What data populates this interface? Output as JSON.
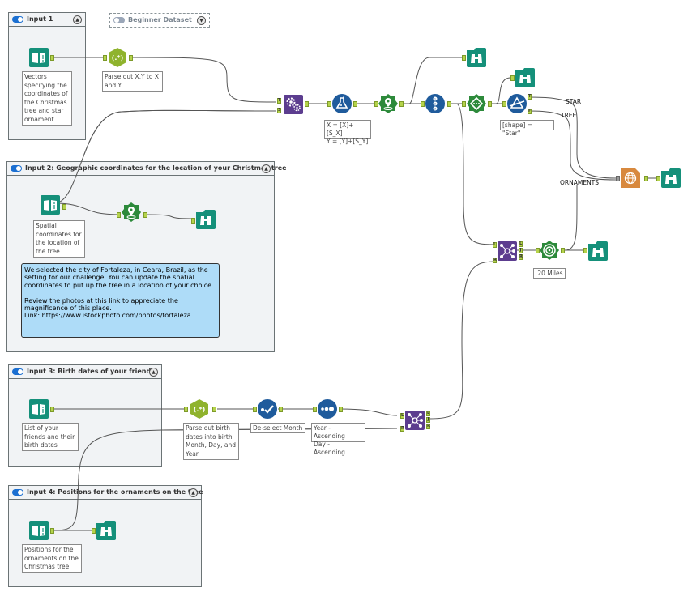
{
  "containers": [
    {
      "id": "input1",
      "title": "Input 1",
      "enabled": true
    },
    {
      "id": "beginner",
      "title": "Beginner Dataset",
      "enabled": false
    },
    {
      "id": "input2",
      "title": "Input 2: Geographic coordinates for the location of your Christmas tree",
      "enabled": true
    },
    {
      "id": "input3",
      "title": "Input 3: Birth dates of your friends",
      "enabled": true
    },
    {
      "id": "input4",
      "title": "Input 4: Positions for the ornaments on the tree",
      "enabled": true
    }
  ],
  "annotations": {
    "input1_text": "Vectors specifying the coordinates of the Christmas tree and star ornament",
    "regex1": "Parse out X,Y to X and Y",
    "formula": "X = [X]+[S_X]\nY = [Y]+[S_Y]",
    "filter": "[shape] = \"Star\"",
    "buffer": ".20 Miles",
    "input2_text": "Spatial coordinates for the location of the tree",
    "input3_text": "List of your friends and their birth dates",
    "regex2": "Parse out birth dates into birth Month, Day, and Year",
    "select": "De-select Month",
    "sort": "Year - Ascending\nDay - Ascending",
    "input4_text": "Positions for the ornaments on the tree"
  },
  "input4_annotation": "Positions for the ornaments on the Christmas tree",
  "comment": "We selected the city of Fortaleza, in Ceara, Brazil, as the setting for our challenge. You can update the spatial coordinates to put up the tree in a location of your choice.\n\nReview the photos at this link to appreciate the magnificence of this place.\nLink: https://www.istockphoto.com/photos/fortaleza",
  "wire_labels": {
    "star": "STAR",
    "tree": "TREE",
    "ornaments": "ORNAMENTS"
  },
  "anchors": {
    "T": "T",
    "S": "S",
    "F": "F",
    "L": "L",
    "R": "R",
    "J": "J"
  },
  "colors": {
    "input_teal": "#15907a",
    "parse_green": "#8fb32d",
    "spatial_purple": "#5c3d8f",
    "prep_blue": "#1f5b9c",
    "spatial_green": "#2d8a3b",
    "report_orange": "#d8893e",
    "browse_teal": "#15907a",
    "comment_blue": "#aedcf8"
  }
}
